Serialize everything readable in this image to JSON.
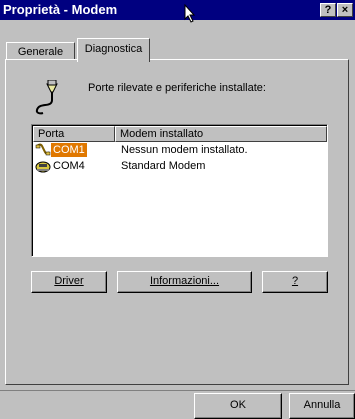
{
  "window": {
    "title": "Proprietà - Modem",
    "help_glyph": "?",
    "close_glyph": "×"
  },
  "tabs": [
    {
      "label": "Generale"
    },
    {
      "label": "Diagnostica"
    }
  ],
  "heading": "Porte rilevate e periferiche installate:",
  "list": {
    "columns": [
      "Porta",
      "Modem installato"
    ],
    "rows": [
      {
        "port": "COM1",
        "modem": "Nessun modem installato.",
        "icon": "serial-cable-icon",
        "selected": true
      },
      {
        "port": "COM4",
        "modem": "Standard Modem",
        "icon": "modem-icon",
        "selected": false
      }
    ]
  },
  "buttons": {
    "driver": "Driver",
    "info": "Informazioni...",
    "help": "?",
    "ok": "OK",
    "cancel": "Annulla"
  },
  "colors": {
    "titlebar": "#000080",
    "selection": "#e07800",
    "face": "#c0c0c0"
  }
}
